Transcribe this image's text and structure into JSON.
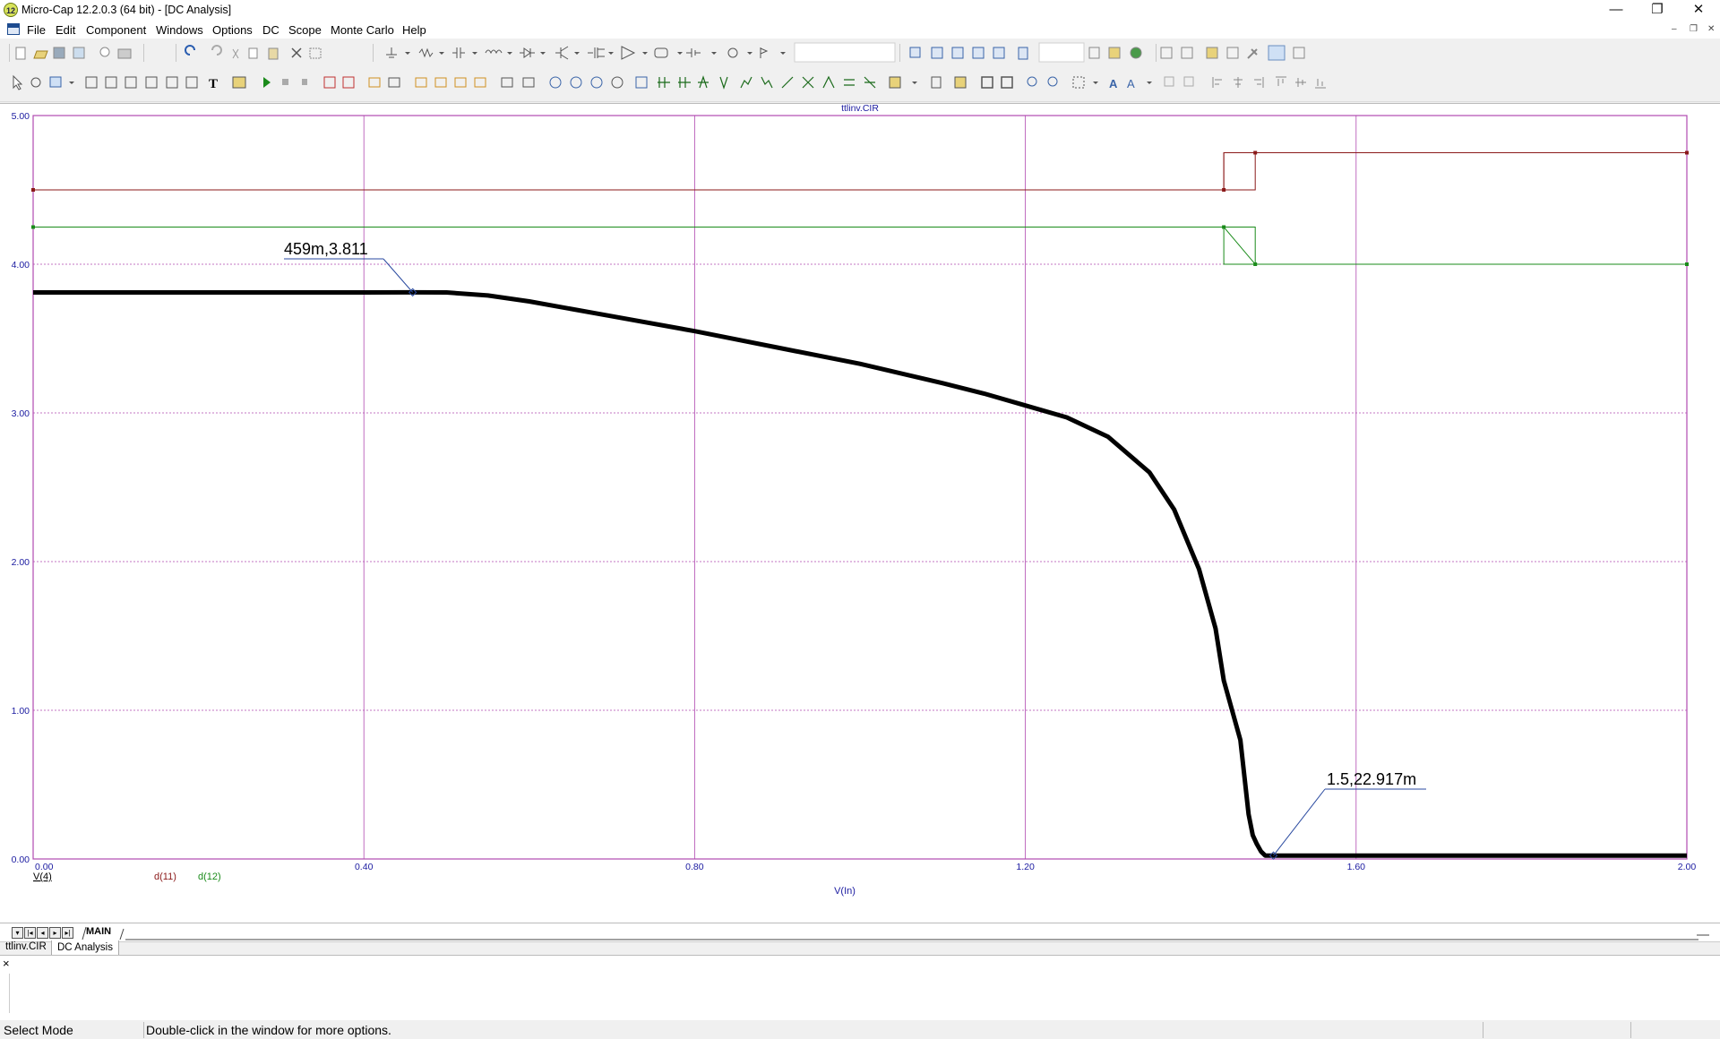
{
  "window": {
    "app_icon_text": "12",
    "title": "Micro-Cap 12.2.0.3 (64 bit) - [DC Analysis]",
    "minimize": "—",
    "restore": "❐",
    "close": "✕"
  },
  "menu": {
    "items": [
      "File",
      "Edit",
      "Component",
      "Windows",
      "Options",
      "DC",
      "Scope",
      "Monte Carlo",
      "Help"
    ],
    "mdi_minimize": "–",
    "mdi_restore": "❐",
    "mdi_close": "✕"
  },
  "plot": {
    "title": "ttlinv.CIR",
    "xlabel": "V(In)",
    "legend": [
      {
        "label": "V(4)",
        "color": "#000000"
      },
      {
        "label": "d(11)",
        "color": "#8b1a1a"
      },
      {
        "label": "d(12)",
        "color": "#1a8b1a"
      }
    ],
    "cursor_labels": [
      "459m,3.811",
      "1.5,22.917m"
    ],
    "grid_color": "#b04ab0"
  },
  "chart_data": {
    "type": "line",
    "title": "ttlinv.CIR",
    "xlabel": "V(In)",
    "ylabel": "",
    "xlim": [
      0,
      2
    ],
    "ylim": [
      0,
      5
    ],
    "xticks": [
      "0.00",
      "0.40",
      "0.80",
      "1.20",
      "1.60",
      "2.00"
    ],
    "yticks": [
      "0.00",
      "1.00",
      "2.00",
      "3.00",
      "4.00",
      "5.00"
    ],
    "grid": true,
    "series": [
      {
        "name": "V(4)",
        "color": "#000000",
        "width": 5,
        "x": [
          0,
          0.2,
          0.4,
          0.459,
          0.5,
          0.55,
          0.6,
          0.7,
          0.8,
          0.9,
          1.0,
          1.1,
          1.15,
          1.2,
          1.25,
          1.3,
          1.35,
          1.38,
          1.41,
          1.43,
          1.44,
          1.46,
          1.465,
          1.47,
          1.475,
          1.48,
          1.485,
          1.49,
          1.5,
          1.55,
          1.6,
          1.8,
          2.0
        ],
        "y": [
          3.81,
          3.81,
          3.81,
          3.811,
          3.81,
          3.79,
          3.75,
          3.65,
          3.55,
          3.44,
          3.33,
          3.2,
          3.13,
          3.05,
          2.97,
          2.84,
          2.6,
          2.35,
          1.95,
          1.55,
          1.2,
          0.8,
          0.55,
          0.3,
          0.16,
          0.1,
          0.05,
          0.023,
          0.023,
          0.023,
          0.023,
          0.023,
          0.023
        ]
      },
      {
        "name": "d(11)",
        "color": "#8b1a1a",
        "width": 1,
        "x": [
          0,
          1.44,
          1.44,
          1.478,
          1.478,
          2.0
        ],
        "y": [
          4.5,
          4.5,
          4.75,
          4.75,
          4.75,
          4.75
        ],
        "markers_x": [
          0,
          1.44,
          1.478,
          2.0
        ],
        "markers_y": [
          4.5,
          4.5,
          4.75,
          4.75
        ],
        "box": {
          "x": [
            1.44,
            1.478
          ],
          "y": [
            4.5,
            4.75
          ]
        }
      },
      {
        "name": "d(12)",
        "color": "#1a8b1a",
        "width": 1,
        "x": [
          0,
          1.44,
          1.478,
          2.0
        ],
        "y": [
          4.25,
          4.25,
          4.0,
          4.0
        ],
        "markers_x": [
          0,
          1.44,
          1.478,
          2.0
        ],
        "markers_y": [
          4.25,
          4.25,
          4.0,
          4.0
        ],
        "box": {
          "x": [
            1.44,
            1.478
          ],
          "y": [
            4.0,
            4.25
          ]
        }
      }
    ],
    "annotations": [
      {
        "text": "459m,3.811",
        "x": 0.459,
        "y": 3.811
      },
      {
        "text": "1.5,22.917m",
        "x": 1.5,
        "y": 0.0229
      }
    ]
  },
  "tabs": {
    "sheet": "MAIN",
    "documents": [
      "ttlinv.CIR",
      "DC Analysis"
    ]
  },
  "output": {
    "close": "×"
  },
  "status": {
    "mode": "Select Mode",
    "hint": "Double-click in the window for more options."
  }
}
